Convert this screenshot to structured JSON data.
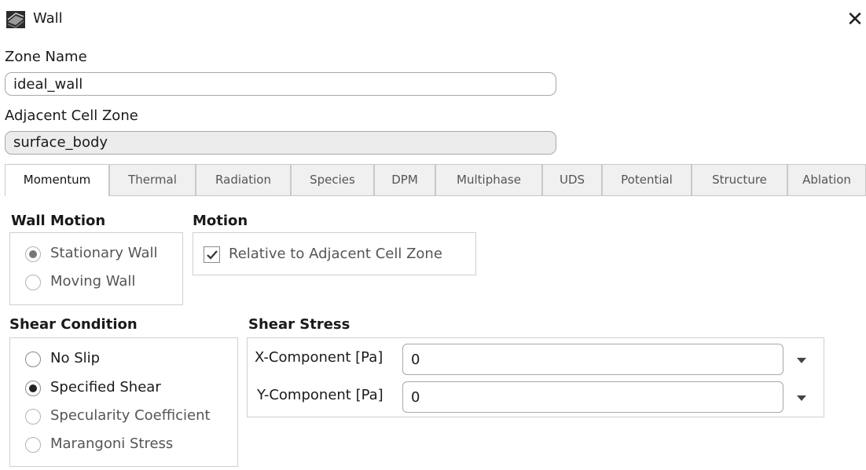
{
  "window": {
    "title": "Wall",
    "icon": "wall-icon",
    "close_glyph": "✕"
  },
  "zone_name": {
    "label": "Zone Name",
    "value": "ideal_wall"
  },
  "adjacent_cell_zone": {
    "label": "Adjacent Cell Zone",
    "value": "surface_body"
  },
  "tabs": [
    "Momentum",
    "Thermal",
    "Radiation",
    "Species",
    "DPM",
    "Multiphase",
    "UDS",
    "Potential",
    "Structure",
    "Ablation"
  ],
  "active_tab": "Momentum",
  "wall_motion": {
    "title": "Wall Motion",
    "options": [
      "Stationary Wall",
      "Moving Wall"
    ],
    "selected": "Stationary Wall"
  },
  "motion": {
    "title": "Motion",
    "checkbox_label": "Relative to Adjacent Cell Zone",
    "checked": true
  },
  "shear_condition": {
    "title": "Shear Condition",
    "options": [
      "No Slip",
      "Specified Shear",
      "Specularity Coefficient",
      "Marangoni Stress"
    ],
    "selected": "Specified Shear"
  },
  "shear_stress": {
    "title": "Shear Stress",
    "x_label": "X-Component [Pa]",
    "x_value": "0",
    "y_label": "Y-Component [Pa]",
    "y_value": "0"
  }
}
